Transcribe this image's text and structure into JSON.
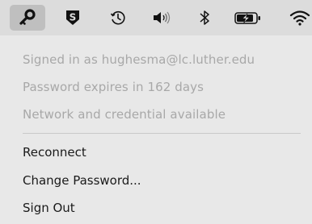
{
  "menubar": {
    "icons": [
      {
        "name": "key-icon",
        "active": true
      },
      {
        "name": "s-app-icon",
        "label": "S"
      },
      {
        "name": "time-machine-icon"
      },
      {
        "name": "volume-icon"
      },
      {
        "name": "bluetooth-icon"
      },
      {
        "name": "battery-charging-icon"
      },
      {
        "name": "wifi-icon"
      }
    ]
  },
  "menu": {
    "info": [
      "Signed in as hughesma@lc.luther.edu",
      "Password expires in 162 days",
      "Network and credential available"
    ],
    "actions": [
      "Reconnect",
      "Change Password...",
      "Sign Out"
    ]
  },
  "colors": {
    "menubar_bg": "#dcdcdc",
    "menu_bg": "#e8e8e8",
    "disabled_text": "#a8a8a8",
    "enabled_text": "#1a1a1a",
    "active_highlight": "#bfbfbf"
  }
}
